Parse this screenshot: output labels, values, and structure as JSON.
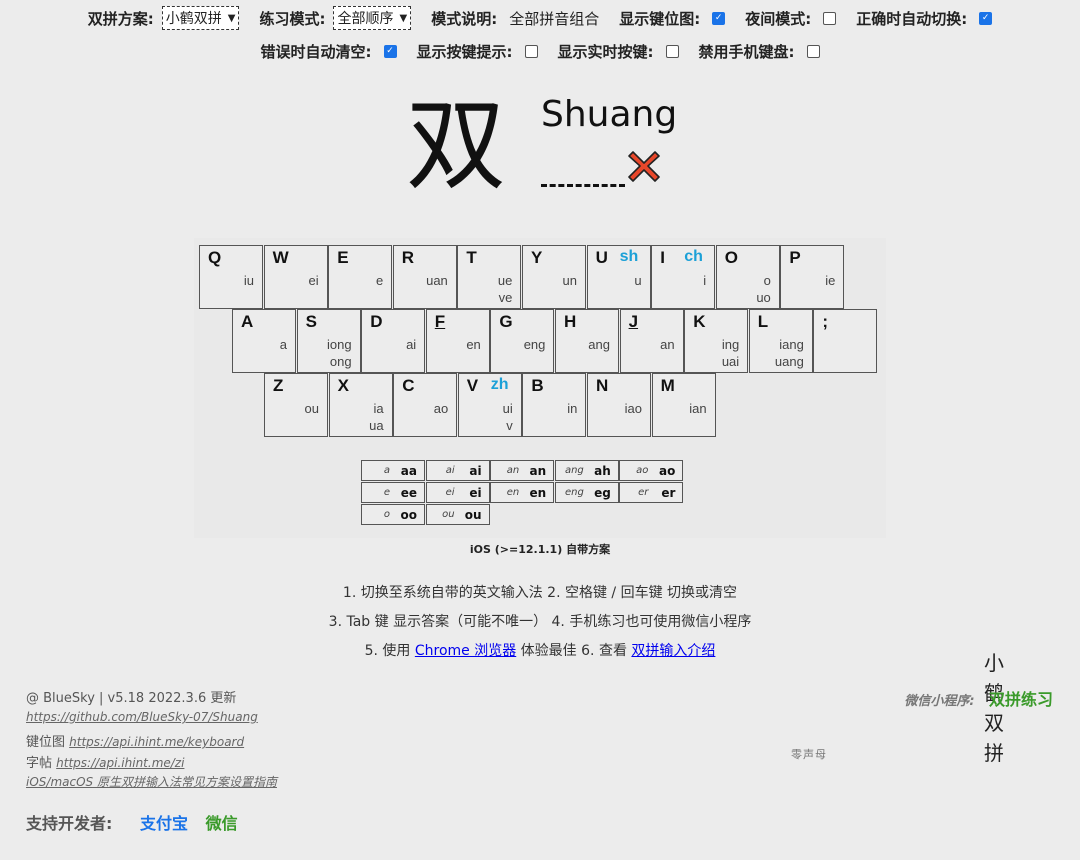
{
  "settings": {
    "scheme_label": "双拼方案:",
    "scheme_value": "小鹤双拼",
    "mode_label": "练习模式:",
    "mode_value": "全部顺序",
    "desc_label": "模式说明:",
    "desc_value": "全部拼音组合",
    "show_layout_label": "显示键位图:",
    "show_layout_checked": true,
    "night_label": "夜间模式:",
    "night_checked": false,
    "auto_switch_label": "正确时自动切换:",
    "auto_switch_checked": true,
    "auto_clear_label": "错误时自动清空:",
    "auto_clear_checked": true,
    "key_hint_label": "显示按键提示:",
    "key_hint_checked": false,
    "realtime_label": "显示实时按键:",
    "realtime_checked": false,
    "disable_mobile_label": "禁用手机键盘:",
    "disable_mobile_checked": false
  },
  "practice": {
    "hanzi": "双",
    "pinyin": "Shuang",
    "result": "wrong"
  },
  "keyboard": {
    "rows": [
      [
        {
          "l": "Q",
          "f": [
            "iu"
          ]
        },
        {
          "l": "W",
          "f": [
            "ei"
          ]
        },
        {
          "l": "E",
          "f": [
            "e"
          ]
        },
        {
          "l": "R",
          "f": [
            "uan"
          ]
        },
        {
          "l": "T",
          "f": [
            "ue",
            "ve"
          ]
        },
        {
          "l": "Y",
          "f": [
            "un"
          ]
        },
        {
          "l": "U",
          "i": "sh",
          "f": [
            "u"
          ]
        },
        {
          "l": "I",
          "i": "ch",
          "f": [
            "i"
          ]
        },
        {
          "l": "O",
          "f": [
            "o",
            "uo"
          ]
        },
        {
          "l": "P",
          "f": [
            "ie"
          ]
        }
      ],
      [
        {
          "l": "A",
          "f": [
            "a"
          ]
        },
        {
          "l": "S",
          "f": [
            "iong",
            "ong"
          ]
        },
        {
          "l": "D",
          "f": [
            "ai"
          ]
        },
        {
          "l": "F",
          "f": [
            "en"
          ],
          "u": true
        },
        {
          "l": "G",
          "f": [
            "eng"
          ]
        },
        {
          "l": "H",
          "f": [
            "ang"
          ]
        },
        {
          "l": "J",
          "f": [
            "an"
          ],
          "u": true
        },
        {
          "l": "K",
          "f": [
            "ing",
            "uai"
          ]
        },
        {
          "l": "L",
          "f": [
            "iang",
            "uang"
          ]
        },
        {
          "l": ";",
          "f": []
        }
      ],
      [
        {
          "l": "Z",
          "f": [
            "ou"
          ]
        },
        {
          "l": "X",
          "f": [
            "ia",
            "ua"
          ]
        },
        {
          "l": "C",
          "f": [
            "ao"
          ]
        },
        {
          "l": "V",
          "i": "zh",
          "f": [
            "ui",
            "v"
          ]
        },
        {
          "l": "B",
          "f": [
            "in"
          ]
        },
        {
          "l": "N",
          "f": [
            "iao"
          ]
        },
        {
          "l": "M",
          "f": [
            "ian"
          ]
        }
      ]
    ],
    "zero_initials": [
      [
        {
          "a": "a",
          "b": "aa"
        },
        {
          "a": "ai",
          "b": "ai"
        },
        {
          "a": "an",
          "b": "an"
        },
        {
          "a": "ang",
          "b": "ah"
        },
        {
          "a": "ao",
          "b": "ao"
        }
      ],
      [
        {
          "a": "e",
          "b": "ee"
        },
        {
          "a": "ei",
          "b": "ei"
        },
        {
          "a": "en",
          "b": "en"
        },
        {
          "a": "eng",
          "b": "eg"
        },
        {
          "a": "er",
          "b": "er"
        }
      ],
      [
        {
          "a": "o",
          "b": "oo"
        },
        {
          "a": "ou",
          "b": "ou"
        }
      ]
    ],
    "zero_label": "零声母",
    "brand_line1": "小鹤",
    "brand_line2": "双拼",
    "ios_note": "iOS (>=12.1.1) 自带方案"
  },
  "tips": {
    "t1": "1. 切换至系统自带的英文输入法   2. 空格键 / 回车键 切换或清空",
    "t3": "3. Tab 键 显示答案（可能不唯一）   4. 手机练习也可使用微信小程序",
    "t5_pre": "5. 使用 ",
    "t5_link": "Chrome 浏览器",
    "t5_mid": " 体验最佳   6. 查看 ",
    "t5_link2": "双拼输入介绍"
  },
  "footer": {
    "version": "@ BlueSky | v5.18 2022.3.6 更新",
    "github": "https://github.com/BlueSky-07/Shuang",
    "keymap_label": "键位图",
    "keymap_link": "https://api.ihint.me/keyboard",
    "zitie_label": "字帖",
    "zitie_link": "https://api.ihint.me/zi",
    "ios_guide": "iOS/macOS 原生双拼输入法常见方案设置指南",
    "wechat_label": "微信小程序:",
    "wechat_name": "双拼练习",
    "support_label": "支持开发者:",
    "alipay": "支付宝",
    "wechat": "微信"
  },
  "colors": {
    "accent": "#1ba0d7",
    "wrong": "#e8472a",
    "link": "#0000ee",
    "green": "#3a9a2a",
    "blue": "#1a73e8"
  }
}
